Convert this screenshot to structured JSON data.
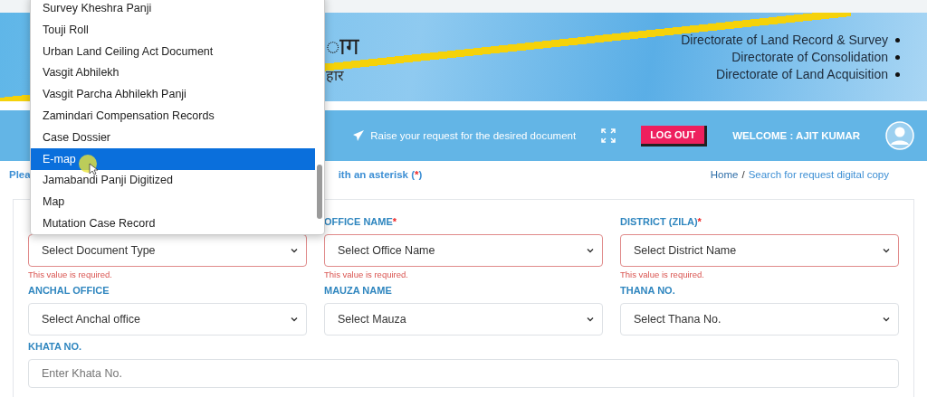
{
  "banner": {
    "title_fragment": "ाग",
    "subtitle_fragment": "हार",
    "directorates": [
      "Directorate of Land Record & Survey",
      "Directorate of Consolidation",
      "Directorate of Land Acquisition"
    ]
  },
  "nav": {
    "request_link": "Raise your request for the desired document",
    "logout_button": "LOG OUT",
    "welcome": "WELCOME : AJIT KUMAR"
  },
  "notice": {
    "start": "Plea",
    "end": "ith an asterisk (",
    "asterisk": "*",
    "close": ")"
  },
  "breadcrumb": [
    {
      "label": "Home",
      "selected": false
    },
    {
      "label": "Search for request digital copy",
      "selected": true
    }
  ],
  "breadcrumb_separator": "/",
  "form": {
    "fields": [
      {
        "kind": "select",
        "placeholder": "Select Document Type",
        "error": "This value is required."
      },
      {
        "kind": "select",
        "label": "OFFICE NAME",
        "asterisk": "*",
        "placeholder": "Select Office Name",
        "error": "This value is required."
      },
      {
        "kind": "select",
        "label": "DISTRICT (ZILA)",
        "asterisk": "*",
        "placeholder": "Select District Name",
        "error": "This value is required."
      },
      {
        "kind": "select",
        "label": "ANCHAL OFFICE",
        "placeholder": "Select Anchal office"
      },
      {
        "kind": "select",
        "label": "MAUZA NAME",
        "placeholder": "Select Mauza"
      },
      {
        "kind": "select",
        "label": "THANA NO.",
        "placeholder": "Select Thana No."
      },
      {
        "kind": "input",
        "label": "KHATA NO.",
        "placeholder": "Enter Khata No."
      }
    ]
  },
  "dropdown": {
    "options": [
      {
        "label": "Survey Kheshra Panji",
        "selected": false
      },
      {
        "label": "Touji Roll",
        "selected": false
      },
      {
        "label": "Urban Land Ceiling Act Document",
        "selected": false
      },
      {
        "label": "Vasgit Abhilekh",
        "selected": false
      },
      {
        "label": "Vasgit Parcha Abhilekh Panji",
        "selected": false
      },
      {
        "label": "Zamindari Compensation Records",
        "selected": false
      },
      {
        "label": "Case Dossier",
        "selected": false
      },
      {
        "label": "E-map",
        "selected": true
      },
      {
        "label": "Jamabandi Panji Digitized",
        "selected": false
      },
      {
        "label": "Map",
        "selected": false
      },
      {
        "label": "Mutation Case Record",
        "selected": false
      }
    ]
  }
}
